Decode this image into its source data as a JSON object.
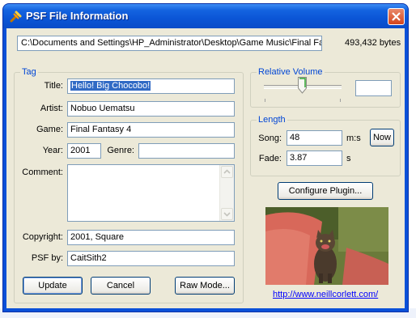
{
  "window": {
    "title": "PSF File Information"
  },
  "file": {
    "path": "C:\\Documents and Settings\\HP_Administrator\\Desktop\\Game Music\\Final Fa",
    "size": "493,432 bytes"
  },
  "tag": {
    "group_label": "Tag",
    "title_label": "Title:",
    "title_value": "Hello! Big Chocobo!",
    "artist_label": "Artist:",
    "artist_value": "Nobuo Uematsu",
    "game_label": "Game:",
    "game_value": "Final Fantasy 4",
    "year_label": "Year:",
    "year_value": "2001",
    "genre_label": "Genre:",
    "genre_value": "",
    "comment_label": "Comment:",
    "comment_value": "",
    "copyright_label": "Copyright:",
    "copyright_value": "2001, Square",
    "psfby_label": "PSF by:",
    "psfby_value": "CaitSith2"
  },
  "volume": {
    "group_label": "Relative Volume",
    "value": "",
    "slider_level": 0.5
  },
  "length": {
    "group_label": "Length",
    "song_label": "Song:",
    "song_value": "48",
    "song_unit": "m:s",
    "fade_label": "Fade:",
    "fade_value": "3.87",
    "fade_unit": "s",
    "now_label": "Now"
  },
  "buttons": {
    "update": "Update",
    "cancel": "Cancel",
    "raw_mode": "Raw Mode...",
    "configure": "Configure Plugin..."
  },
  "link": "http://www.neillcorlett.com/",
  "colors": {
    "titlebar": "#0b55d6",
    "client": "#ece9d8",
    "group_title": "#0046d5",
    "selection": "#316ac5",
    "link": "#0000ff"
  },
  "icons": [
    "wrench-icon",
    "close-icon",
    "scroll-up-icon",
    "scroll-down-icon"
  ]
}
